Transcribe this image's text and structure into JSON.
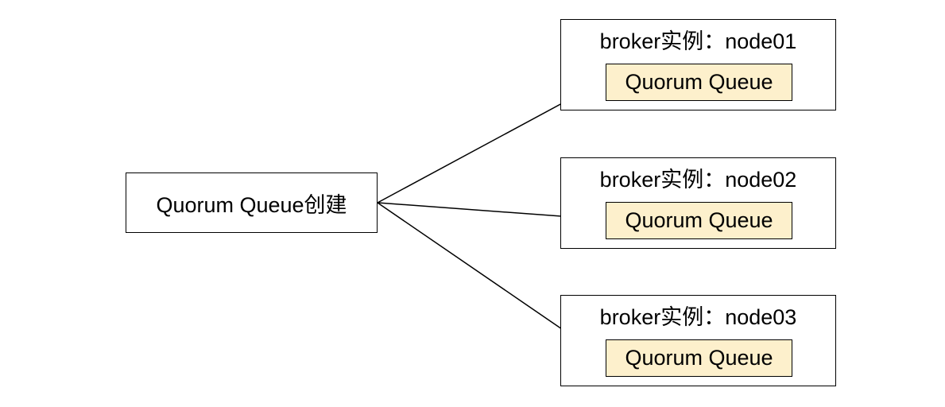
{
  "source": {
    "label": "Quorum Queue创建"
  },
  "brokers": [
    {
      "title": "broker实例：node01",
      "queue": "Quorum Queue"
    },
    {
      "title": "broker实例：node02",
      "queue": "Quorum Queue"
    },
    {
      "title": "broker实例：node03",
      "queue": "Quorum Queue"
    }
  ],
  "colors": {
    "queue_fill": "#fdf0cc",
    "stroke": "#000000"
  }
}
